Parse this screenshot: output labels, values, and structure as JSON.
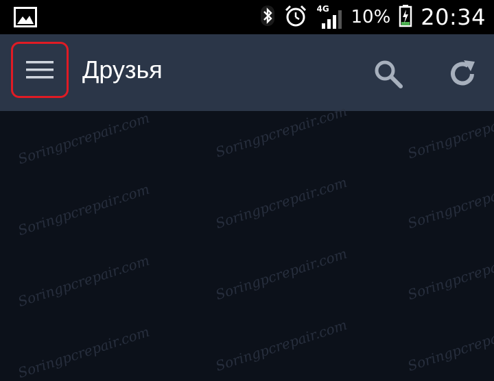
{
  "status_bar": {
    "network_type": "4G",
    "battery_percent": "10%",
    "time": "20:34"
  },
  "app_bar": {
    "title": "Друзья"
  },
  "watermark": {
    "text": "Soringpcrepair.com"
  }
}
